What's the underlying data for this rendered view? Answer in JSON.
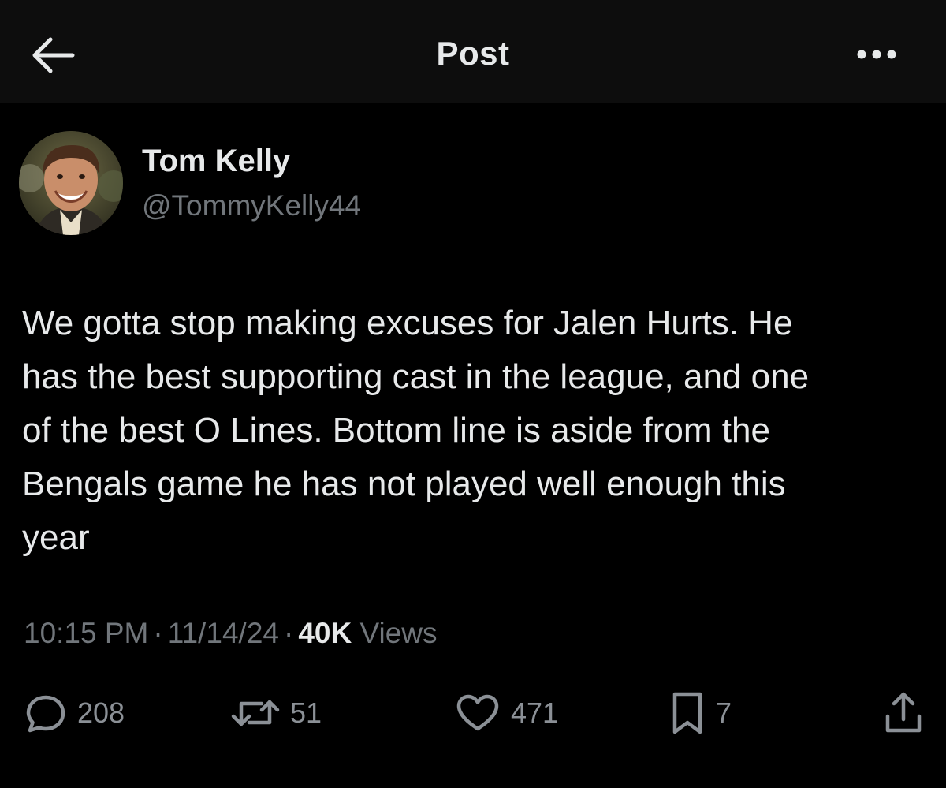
{
  "header": {
    "title": "Post"
  },
  "author": {
    "name": "Tom Kelly",
    "handle": "@TommyKelly44"
  },
  "post": {
    "lines": [
      "We gotta stop making excuses for Jalen Hurts. He",
      "has the best supporting cast in the league, and one",
      "of the best O Lines. Bottom line is aside from the",
      "Bengals game he has not played well enough this",
      "year"
    ]
  },
  "meta": {
    "time": "10:15 PM",
    "date": "11/14/24",
    "views_count": "40K",
    "views_label": "Views",
    "separator": "·"
  },
  "actions": {
    "replies": "208",
    "reposts": "51",
    "likes": "471",
    "bookmarks": "7"
  },
  "icons": {
    "back": "back-arrow-icon",
    "more": "more-dots-icon",
    "reply": "reply-bubble-icon",
    "repost": "repost-icon",
    "like": "heart-icon",
    "bookmark": "bookmark-icon",
    "share": "share-icon"
  },
  "colors": {
    "background": "#000000",
    "header_background": "#0d0d0d",
    "text_primary": "#e7e9ea",
    "text_secondary": "#71767b"
  }
}
